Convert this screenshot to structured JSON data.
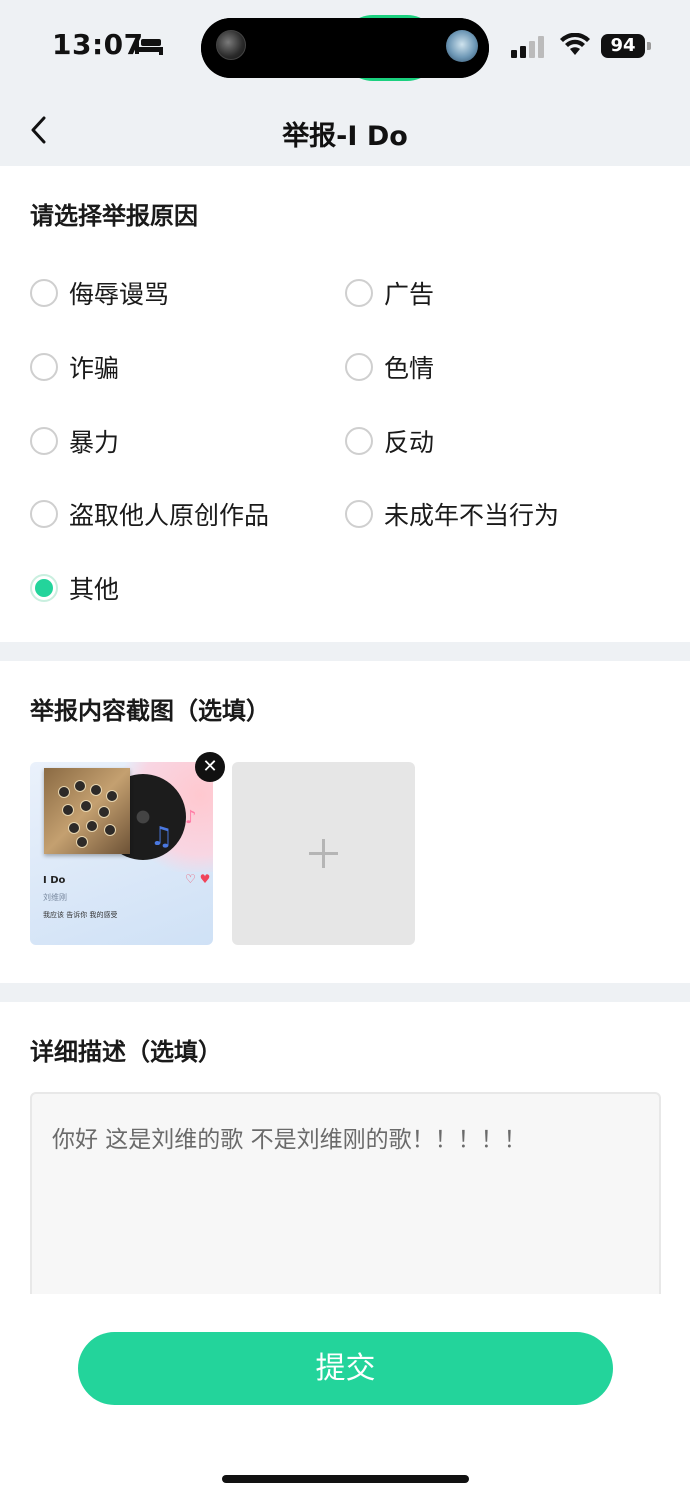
{
  "status_bar": {
    "time": "13:07",
    "battery": "94"
  },
  "nav": {
    "title": "举报-I Do"
  },
  "reasons": {
    "title": "请选择举报原因",
    "options": [
      {
        "label": "侮辱谩骂",
        "checked": false
      },
      {
        "label": "广告",
        "checked": false
      },
      {
        "label": "诈骗",
        "checked": false
      },
      {
        "label": "色情",
        "checked": false
      },
      {
        "label": "暴力",
        "checked": false
      },
      {
        "label": "反动",
        "checked": false
      },
      {
        "label": "盗取他人原创作品",
        "checked": false
      },
      {
        "label": "未成年不当行为",
        "checked": false
      },
      {
        "label": "其他",
        "checked": true
      }
    ]
  },
  "screenshots": {
    "title": "举报内容截图（选填）",
    "thumb": {
      "song_title": "I Do",
      "artist": "刘维刚",
      "lyric": "我应该 告诉你 我的感受"
    },
    "remove_icon": "✕",
    "add_icon": "+"
  },
  "description": {
    "title": "详细描述（选填）",
    "value": "你好 这是刘维的歌 不是刘维刚的歌！！！！！"
  },
  "submit": {
    "label": "提交"
  },
  "colors": {
    "accent": "#23d49b",
    "page_bg": "#eef1f4"
  }
}
